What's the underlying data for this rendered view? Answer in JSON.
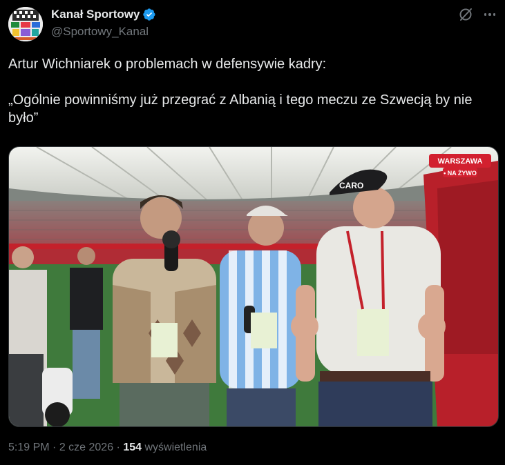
{
  "author": {
    "display_name": "Kanał Sportowy",
    "handle": "@Sportowy_Kanal",
    "verified": true
  },
  "tweet": {
    "line1": "Artur Wichniarek o problemach w defensywie kadry:",
    "line2": "„Ogólnie powinniśmy już przegrać z Albanią i tego meczu ze Szwecją by nie było”"
  },
  "media": {
    "badge_top": "WARSZAWA",
    "badge_bottom": "• NA ŻYWO",
    "cap_brand": "CARO"
  },
  "meta": {
    "time": "5:19 PM",
    "dot1": " · ",
    "date": "2 cze 2026",
    "dot2": " · ",
    "views_count": "154",
    "views_label": " wyświetlenia"
  },
  "icons": {
    "verified": "verified-badge-icon",
    "grok": "grok-icon",
    "more": "more-icon"
  },
  "colors": {
    "background": "#000000",
    "text": "#e7e9ea",
    "secondary": "#71767b",
    "verified": "#1d9bf0",
    "live_badge": "#d2202f"
  }
}
